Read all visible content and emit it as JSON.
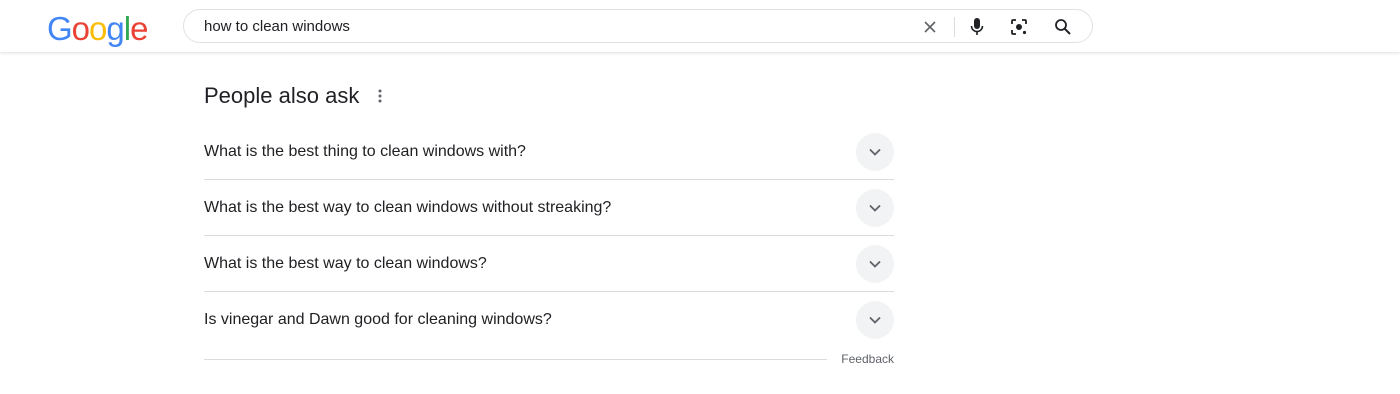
{
  "logo": {
    "letters": [
      "G",
      "o",
      "o",
      "g",
      "l",
      "e"
    ],
    "colors": [
      "#4285F4",
      "#EA4335",
      "#FBBC05",
      "#4285F4",
      "#34A853",
      "#EA4335"
    ]
  },
  "search": {
    "query": "how to clean windows",
    "icons": [
      "close-icon",
      "microphone-icon",
      "camera-lens-icon",
      "search-icon"
    ]
  },
  "paa": {
    "title": "People also ask",
    "more_icon": "more-vert-icon",
    "questions": [
      "What is the best thing to clean windows with?",
      "What is the best way to clean windows without streaking?",
      "What is the best way to clean windows?",
      "Is vinegar and Dawn good for cleaning windows?"
    ],
    "expand_icon": "chevron-down-icon",
    "feedback": "Feedback"
  },
  "colors": {
    "text": "#202124",
    "secondary_text": "#5f6368",
    "divider": "#dadce0",
    "chevron_bg": "#f1f3f4"
  }
}
